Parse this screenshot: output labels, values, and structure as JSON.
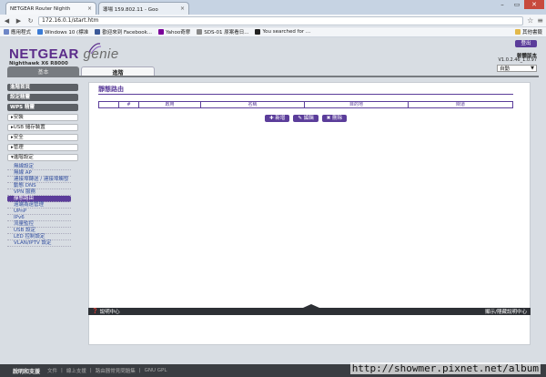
{
  "browser": {
    "tabs": [
      {
        "label": "NETGEAR Router Nighth",
        "close": "×"
      },
      {
        "label": "導場 159.802.11 - Goo",
        "close": "×"
      }
    ],
    "url": "172.16.0.1/start.htm",
    "bookmarks": [
      {
        "label": "應用程式",
        "color": "#6e86c6"
      },
      {
        "label": "Windows 10 (標准",
        "color": "#3a7bd5"
      },
      {
        "label": "歡迎來到 Facebook...",
        "color": "#3b5998"
      },
      {
        "label": "Yahoo奇摩",
        "color": "#7b0099"
      },
      {
        "label": "SDS-01 原案看日...",
        "color": "#888888"
      },
      {
        "label": "You searched for ...",
        "color": "#222222"
      }
    ],
    "other_bookmarks": "其他書籤"
  },
  "header": {
    "brand": "NETGEAR",
    "brand_genie": "genie",
    "model": "Nighthawk X6 R8000",
    "logout": "登出",
    "fw_label": "韌體版本",
    "fw_version": "V1.0.2.46_1.0.97",
    "mode_select": "自動",
    "tabs": {
      "basic": "基本",
      "advanced": "進階"
    }
  },
  "sidebar": {
    "top_items": [
      "進階首頁",
      "設定精靈",
      "WPS 精靈"
    ],
    "groups": [
      "▸安裝",
      "▸USB 儲存裝置",
      "▸安全",
      "▸管理",
      "▾進階設定"
    ],
    "sub_items": [
      "無線設定",
      "無線 AP",
      "連接埠轉送 / 連接埠觸發",
      "動態 DNS",
      "VPN 服務",
      "靜態路由",
      "遠端為遠管理",
      "UPnP",
      "IPv6",
      "流量監控",
      "USB 設定",
      "LED 控制設定",
      "VLAN/IPTV 設定"
    ],
    "active_sub": 5
  },
  "content": {
    "title": "靜態路由",
    "columns": [
      "",
      "#",
      "啟用",
      "名稱",
      "目的地",
      "閘道"
    ],
    "buttons": {
      "add": "✚ 新增",
      "edit": "✎ 編輯",
      "delete": "✖ 刪除"
    }
  },
  "helpbar": {
    "left": "說明中心",
    "right": "顯示/隱藏說明中心"
  },
  "footer": {
    "title": "說明和支援",
    "links": [
      "文件",
      "線上支援",
      "路由器常見問題集",
      "GNU GPL"
    ]
  },
  "watermark": "http://showmer.pixnet.net/album"
}
